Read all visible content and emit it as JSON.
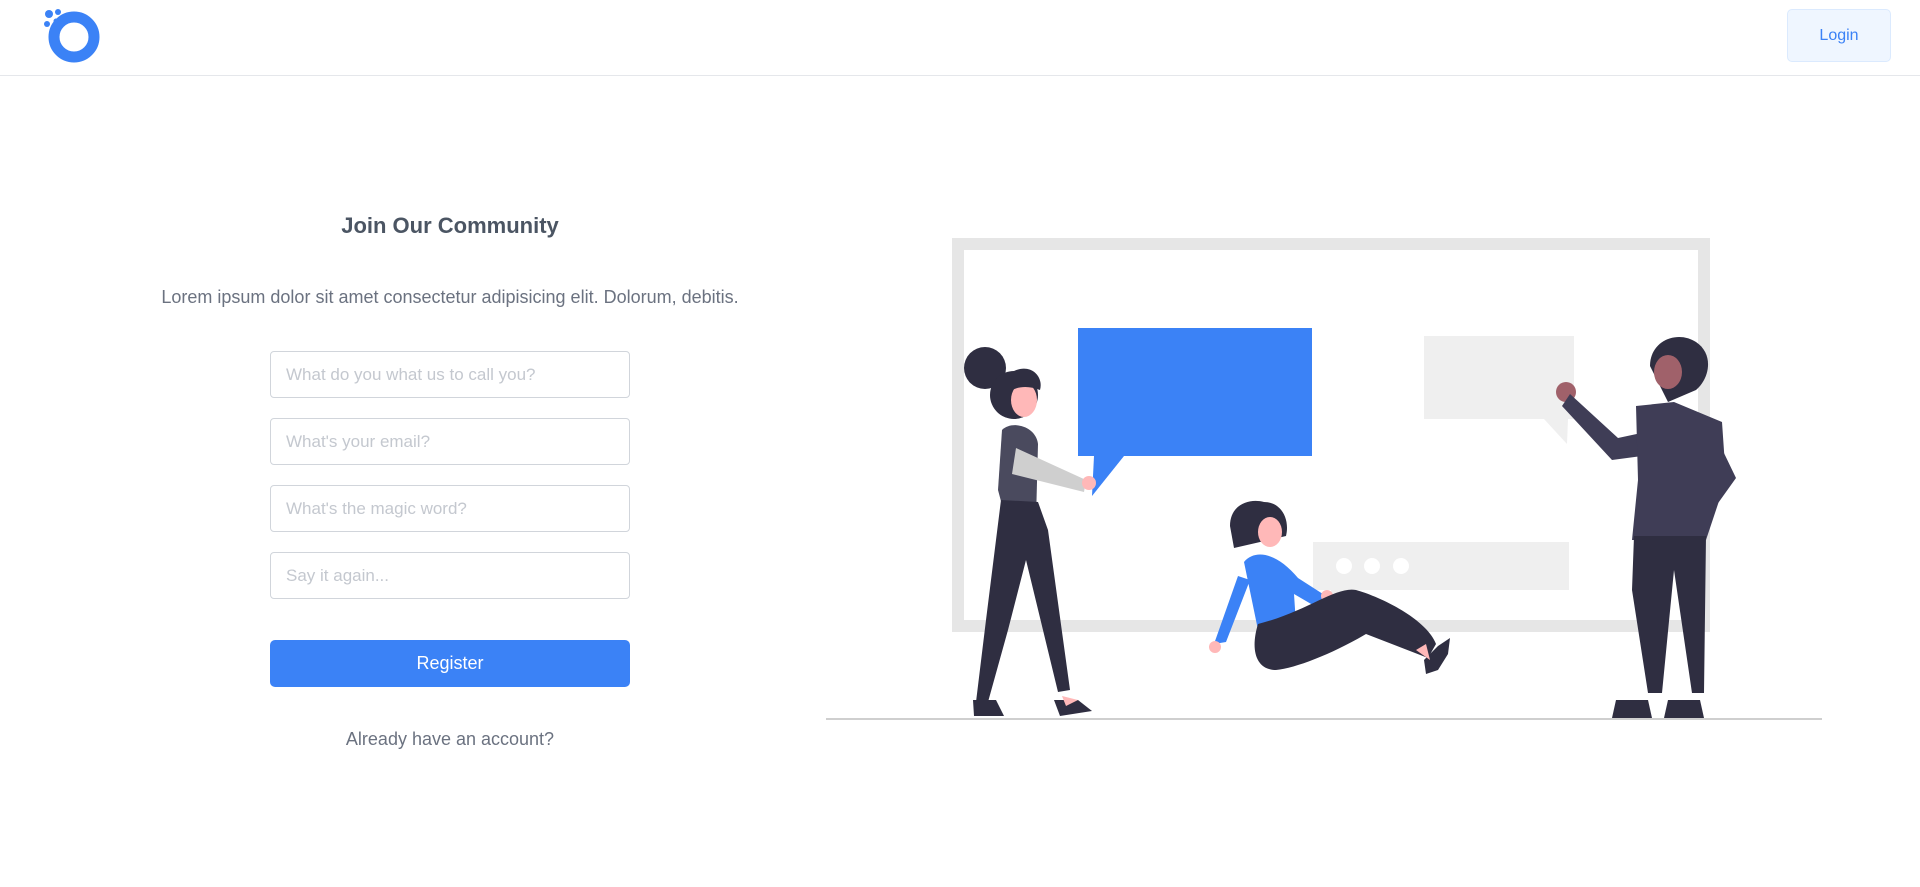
{
  "header": {
    "logo": "brand-logo-icon",
    "login_label": "Login"
  },
  "form": {
    "title": "Join Our Community",
    "subtitle": "Lorem ipsum dolor sit amet consectetur adipisicing elit. Dolorum, debitis.",
    "fields": [
      {
        "value": "",
        "placeholder": "What do you what us to call you?"
      },
      {
        "value": "",
        "placeholder": "What's your email?"
      },
      {
        "value": "",
        "placeholder": "What's the magic word?"
      },
      {
        "value": "",
        "placeholder": "Say it again..."
      }
    ],
    "register_label": "Register",
    "already_label": "Already have an account?"
  },
  "illustration": {
    "subject": "people-chatting-illustration"
  },
  "colors": {
    "accent": "#3b82f6",
    "text": "#4b5563",
    "muted": "#6b7280",
    "border": "#d1d5db",
    "dark_figure": "#2f2e41",
    "skin_light": "#ffb8b8",
    "skin_dark": "#a0616a",
    "frame_grey": "#e6e6e6"
  }
}
